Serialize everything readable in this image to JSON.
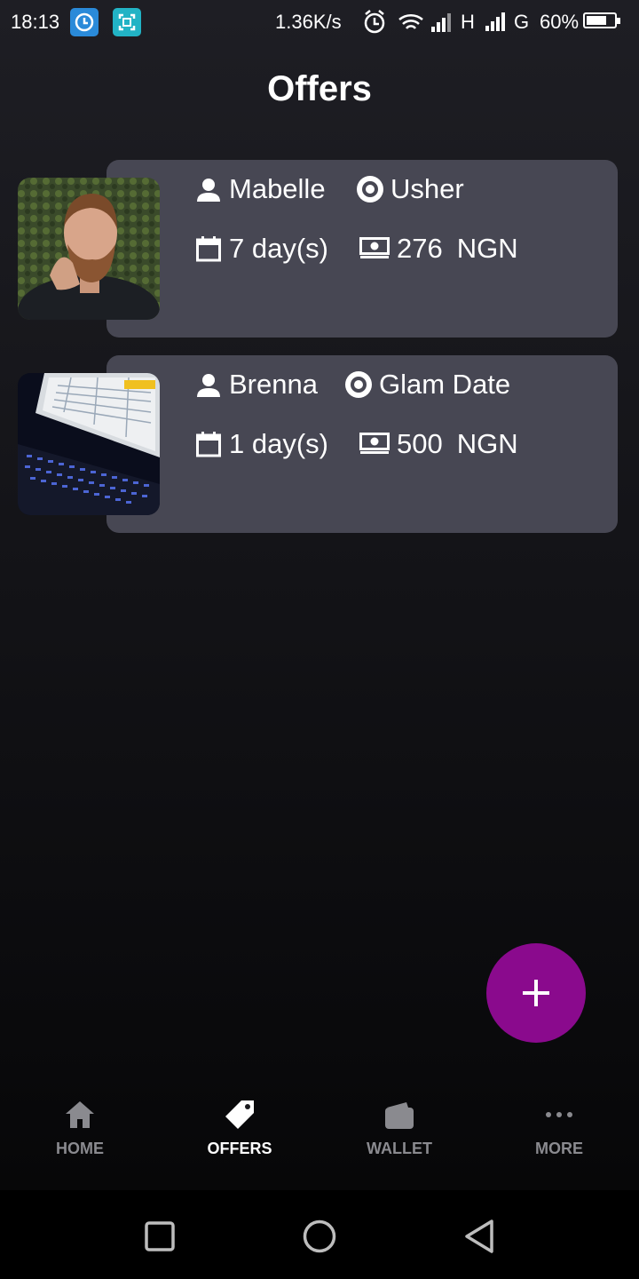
{
  "status_bar": {
    "time": "18:13",
    "net_speed": "1.36K/s",
    "net1": "H",
    "net2": "G",
    "battery": "60%",
    "battery_level": 0.6
  },
  "header": {
    "title": "Offers"
  },
  "offers": [
    {
      "name": "Mabelle",
      "category": "Usher",
      "duration": "7 day(s)",
      "amount": "276",
      "currency": "NGN"
    },
    {
      "name": "Brenna",
      "category": "Glam Date",
      "duration": "1 day(s)",
      "amount": "500",
      "currency": "NGN"
    }
  ],
  "fab": {
    "icon": "plus-icon"
  },
  "nav": [
    {
      "label": "HOME",
      "icon": "home-icon"
    },
    {
      "label": "OFFERS",
      "icon": "tag-icon",
      "active": true
    },
    {
      "label": "WALLET",
      "icon": "wallet-icon"
    },
    {
      "label": "MORE",
      "icon": "more-icon"
    }
  ],
  "colors": {
    "background_top": "#1e1e24",
    "card": "#474753",
    "fab": "#8a0a8d",
    "nav_inactive": "#8a8a8f",
    "nav_active": "#ffffff"
  }
}
